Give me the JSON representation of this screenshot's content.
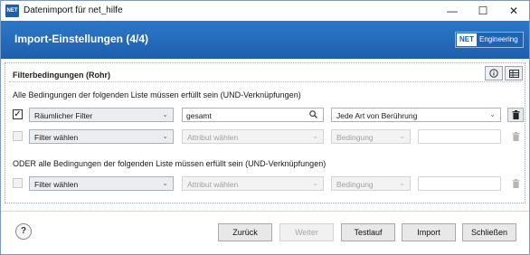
{
  "window": {
    "app_icon_text": "NET",
    "title": "Datenimport für net_hilfe",
    "controls": {
      "minimize": "—",
      "maximize": "☐",
      "close": "✕"
    }
  },
  "header": {
    "title": "Import-Einstellungen (4/4)",
    "brand_logo": "NET",
    "brand_name": "Engineering",
    "colors": {
      "band_top": "#2d78c8",
      "band_bottom": "#1d5fae"
    }
  },
  "filter_group": {
    "title": "Filterbedingungen (Rohr)",
    "info_icon": "info-icon",
    "table_icon": "table-icon",
    "and_section": {
      "label": "Alle Bedingungen der folgenden Liste müssen erfüllt sein (UND-Verknüpfungen)",
      "rows": [
        {
          "checked": true,
          "filter": "Räumlicher Filter",
          "attribute": "gesamt",
          "condition": "Jede Art von Berührung",
          "value": ""
        },
        {
          "checked": false,
          "filter": "Filter wählen",
          "attribute": "Attribut wählen",
          "condition": "Bedingung",
          "value": ""
        }
      ]
    },
    "or_section": {
      "label": "ODER alle Bedingungen der folgenden Liste müssen erfüllt sein (UND-Verknüpfungen)",
      "rows": [
        {
          "checked": false,
          "filter": "Filter wählen",
          "attribute": "Attribut wählen",
          "condition": "Bedingung",
          "value": ""
        }
      ]
    }
  },
  "footer": {
    "help": "?",
    "buttons": {
      "back": "Zurück",
      "next": "Weiter",
      "test": "Testlauf",
      "import": "Import",
      "close": "Schließen"
    }
  }
}
